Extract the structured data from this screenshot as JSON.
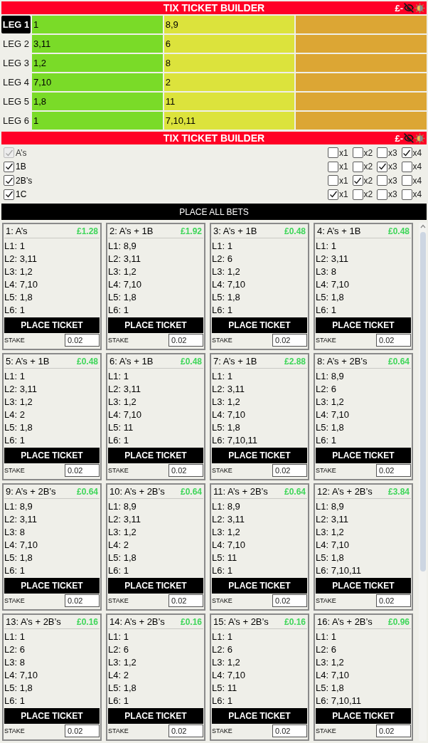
{
  "headers": [
    {
      "title": "TIX TICKET BUILDER",
      "balance": "£-"
    },
    {
      "title": "TIX TICKET BUILDER",
      "balance": "£-"
    }
  ],
  "tiers": [
    {
      "color": "#7adb28"
    },
    {
      "color": "#dce33c"
    },
    {
      "color": "#dca634"
    }
  ],
  "legs": [
    {
      "label": "LEG 1",
      "selected": true,
      "picks": [
        "1",
        "8,9"
      ]
    },
    {
      "label": "LEG 2",
      "selected": false,
      "picks": [
        "3,11",
        "6"
      ]
    },
    {
      "label": "LEG 3",
      "selected": false,
      "picks": [
        "1,2",
        "8"
      ]
    },
    {
      "label": "LEG 4",
      "selected": false,
      "picks": [
        "7,10",
        "2"
      ]
    },
    {
      "label": "LEG 5",
      "selected": false,
      "picks": [
        "1,8",
        "11"
      ]
    },
    {
      "label": "LEG 6",
      "selected": false,
      "picks": [
        "1",
        "7,10,11"
      ]
    }
  ],
  "options": [
    {
      "label": "A’s",
      "checked": true,
      "disabled": true,
      "multipliers": [
        {
          "label": "x1",
          "checked": false
        },
        {
          "label": "x2",
          "checked": false
        },
        {
          "label": "x3",
          "checked": false
        },
        {
          "label": "x4",
          "checked": true
        }
      ]
    },
    {
      "label": "1B",
      "checked": true,
      "disabled": false,
      "multipliers": [
        {
          "label": "x1",
          "checked": false
        },
        {
          "label": "x2",
          "checked": false
        },
        {
          "label": "x3",
          "checked": true
        },
        {
          "label": "x4",
          "checked": false
        }
      ]
    },
    {
      "label": "2B’s",
      "checked": true,
      "disabled": false,
      "multipliers": [
        {
          "label": "x1",
          "checked": false
        },
        {
          "label": "x2",
          "checked": true
        },
        {
          "label": "x3",
          "checked": false
        },
        {
          "label": "x4",
          "checked": false
        }
      ]
    },
    {
      "label": "1C",
      "checked": true,
      "disabled": false,
      "multipliers": [
        {
          "label": "x1",
          "checked": true
        },
        {
          "label": "x2",
          "checked": false
        },
        {
          "label": "x3",
          "checked": false
        },
        {
          "label": "x4",
          "checked": false
        }
      ]
    }
  ],
  "place_all_button": "PLACE ALL BETS",
  "tickets": [
    {
      "title": "1: A’s",
      "amount": "£1.28",
      "lines": [
        "L1: 1",
        "L2: 3,11",
        "L3: 1,2",
        "L4: 7,10",
        "L5: 1,8",
        "L6: 1"
      ],
      "button": "PLACE TICKET",
      "stake_label": "STAKE",
      "stake": "0.02"
    },
    {
      "title": "2: A’s + 1B",
      "amount": "£1.92",
      "lines": [
        "L1: 8,9",
        "L2: 3,11",
        "L3: 1,2",
        "L4: 7,10",
        "L5: 1,8",
        "L6: 1"
      ],
      "button": "PLACE TICKET",
      "stake_label": "STAKE",
      "stake": "0.02"
    },
    {
      "title": "3: A’s + 1B",
      "amount": "£0.48",
      "lines": [
        "L1: 1",
        "L2: 6",
        "L3: 1,2",
        "L4: 7,10",
        "L5: 1,8",
        "L6: 1"
      ],
      "button": "PLACE TICKET",
      "stake_label": "STAKE",
      "stake": "0.02"
    },
    {
      "title": "4: A’s + 1B",
      "amount": "£0.48",
      "lines": [
        "L1: 1",
        "L2: 3,11",
        "L3: 8",
        "L4: 7,10",
        "L5: 1,8",
        "L6: 1"
      ],
      "button": "PLACE TICKET",
      "stake_label": "STAKE",
      "stake": "0.02"
    },
    {
      "title": "5: A’s + 1B",
      "amount": "£0.48",
      "lines": [
        "L1: 1",
        "L2: 3,11",
        "L3: 1,2",
        "L4: 2",
        "L5: 1,8",
        "L6: 1"
      ],
      "button": "PLACE TICKET",
      "stake_label": "STAKE",
      "stake": "0.02"
    },
    {
      "title": "6: A’s + 1B",
      "amount": "£0.48",
      "lines": [
        "L1: 1",
        "L2: 3,11",
        "L3: 1,2",
        "L4: 7,10",
        "L5: 11",
        "L6: 1"
      ],
      "button": "PLACE TICKET",
      "stake_label": "STAKE",
      "stake": "0.02"
    },
    {
      "title": "7: A’s + 1B",
      "amount": "£2.88",
      "lines": [
        "L1: 1",
        "L2: 3,11",
        "L3: 1,2",
        "L4: 7,10",
        "L5: 1,8",
        "L6: 7,10,11"
      ],
      "button": "PLACE TICKET",
      "stake_label": "STAKE",
      "stake": "0.02"
    },
    {
      "title": "8: A’s + 2B’s",
      "amount": "£0.64",
      "lines": [
        "L1: 8,9",
        "L2: 6",
        "L3: 1,2",
        "L4: 7,10",
        "L5: 1,8",
        "L6: 1"
      ],
      "button": "PLACE TICKET",
      "stake_label": "STAKE",
      "stake": "0.02"
    },
    {
      "title": "9: A’s + 2B’s",
      "amount": "£0.64",
      "lines": [
        "L1: 8,9",
        "L2: 3,11",
        "L3: 8",
        "L4: 7,10",
        "L5: 1,8",
        "L6: 1"
      ],
      "button": "PLACE TICKET",
      "stake_label": "STAKE",
      "stake": "0.02"
    },
    {
      "title": "10: A’s + 2B’s",
      "amount": "£0.64",
      "lines": [
        "L1: 8,9",
        "L2: 3,11",
        "L3: 1,2",
        "L4: 2",
        "L5: 1,8",
        "L6: 1"
      ],
      "button": "PLACE TICKET",
      "stake_label": "STAKE",
      "stake": "0.02"
    },
    {
      "title": "11: A’s + 2B’s",
      "amount": "£0.64",
      "lines": [
        "L1: 8,9",
        "L2: 3,11",
        "L3: 1,2",
        "L4: 7,10",
        "L5: 11",
        "L6: 1"
      ],
      "button": "PLACE TICKET",
      "stake_label": "STAKE",
      "stake": "0.02"
    },
    {
      "title": "12: A’s + 2B’s",
      "amount": "£3.84",
      "lines": [
        "L1: 8,9",
        "L2: 3,11",
        "L3: 1,2",
        "L4: 7,10",
        "L5: 1,8",
        "L6: 7,10,11"
      ],
      "button": "PLACE TICKET",
      "stake_label": "STAKE",
      "stake": "0.02"
    },
    {
      "title": "13: A’s + 2B’s",
      "amount": "£0.16",
      "lines": [
        "L1: 1",
        "L2: 6",
        "L3: 8",
        "L4: 7,10",
        "L5: 1,8",
        "L6: 1"
      ],
      "button": "PLACE TICKET",
      "stake_label": "STAKE",
      "stake": "0.02"
    },
    {
      "title": "14: A’s + 2B’s",
      "amount": "£0.16",
      "lines": [
        "L1: 1",
        "L2: 6",
        "L3: 1,2",
        "L4: 2",
        "L5: 1,8",
        "L6: 1"
      ],
      "button": "PLACE TICKET",
      "stake_label": "STAKE",
      "stake": "0.02"
    },
    {
      "title": "15: A’s + 2B’s",
      "amount": "£0.16",
      "lines": [
        "L1: 1",
        "L2: 6",
        "L3: 1,2",
        "L4: 7,10",
        "L5: 11",
        "L6: 1"
      ],
      "button": "PLACE TICKET",
      "stake_label": "STAKE",
      "stake": "0.02"
    },
    {
      "title": "16: A’s + 2B’s",
      "amount": "£0.96",
      "lines": [
        "L1: 1",
        "L2: 6",
        "L3: 1,2",
        "L4: 7,10",
        "L5: 1,8",
        "L6: 7,10,11"
      ],
      "button": "PLACE TICKET",
      "stake_label": "STAKE",
      "stake": "0.02"
    }
  ]
}
